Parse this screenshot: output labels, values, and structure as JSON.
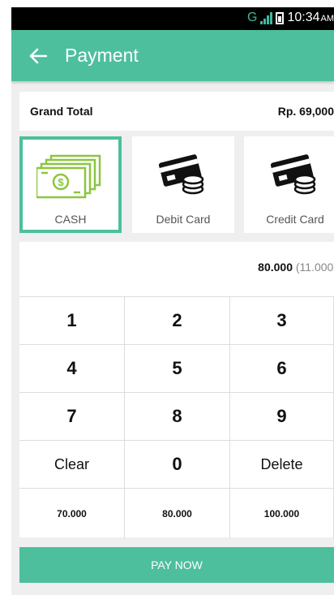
{
  "status_bar": {
    "network": "G",
    "time": "10:34",
    "ampm": "AM"
  },
  "app_bar": {
    "title": "Payment",
    "back_icon": "arrow-left-icon"
  },
  "grand_total": {
    "label": "Grand Total",
    "value": "Rp. 69,000"
  },
  "payment_methods": [
    {
      "label": "CASH",
      "icon": "cash-icon",
      "selected": true
    },
    {
      "label": "Debit Card",
      "icon": "card-coins-icon",
      "selected": false
    },
    {
      "label": "Credit Card",
      "icon": "card-coins-icon",
      "selected": false
    }
  ],
  "amount": {
    "entered": "80.000",
    "change": "(11.000)"
  },
  "keypad": {
    "rows": [
      [
        "1",
        "2",
        "3"
      ],
      [
        "4",
        "5",
        "6"
      ],
      [
        "7",
        "8",
        "9"
      ],
      [
        "Clear",
        "0",
        "Delete"
      ],
      [
        "70.000",
        "80.000",
        "100.000"
      ]
    ]
  },
  "pay_button": "PAY NOW",
  "colors": {
    "accent": "#4dbf9d",
    "cash_green": "#8cc63f",
    "background": "#efefef"
  }
}
